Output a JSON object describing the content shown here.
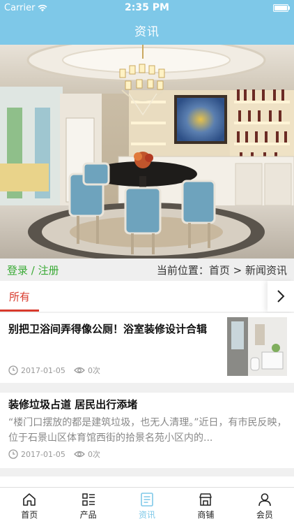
{
  "status_bar": {
    "carrier": "Carrier",
    "time": "2:35 PM"
  },
  "nav": {
    "title": "资讯"
  },
  "hero": {
    "icon": "dining-room-photo"
  },
  "location_bar": {
    "login": "登录",
    "separator": " / ",
    "register": "注册",
    "breadcrumb": "当前位置：首页 > 新闻资讯"
  },
  "tabs": {
    "active": "所有"
  },
  "articles": [
    {
      "title": "别把卫浴间弄得像公厕！浴室装修设计合辑",
      "date": "2017-01-05",
      "views": "0次"
    },
    {
      "title": "装修垃圾占道 居民出行添堵",
      "summary": "“楼门口摆放的都是建筑垃圾，也无人清理。”近日，有市民反映，位于石景山区体育馆西街的拾景名苑小区内的...",
      "date": "2017-01-05",
      "views": "0次"
    }
  ],
  "tabbar": [
    {
      "label": "首页",
      "icon": "home-icon"
    },
    {
      "label": "产品",
      "icon": "list-icon"
    },
    {
      "label": "资讯",
      "icon": "news-icon",
      "active": true
    },
    {
      "label": "商铺",
      "icon": "shop-icon"
    },
    {
      "label": "会员",
      "icon": "user-icon"
    }
  ],
  "colors": {
    "header": "#7ec8e8",
    "accent_red": "#d83a2c",
    "link_green": "#3aaa35"
  }
}
